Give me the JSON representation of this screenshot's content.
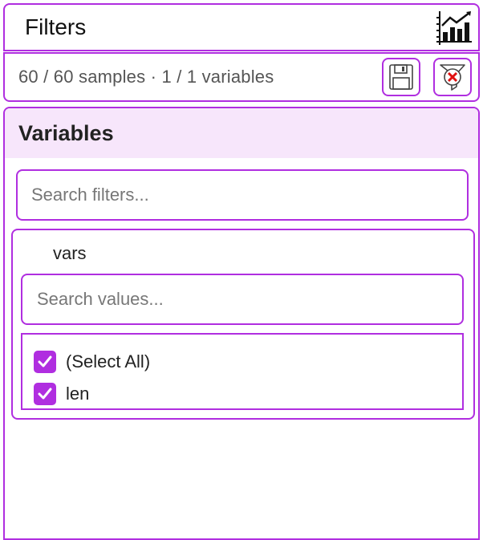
{
  "header": {
    "title": "Filters",
    "chart_icon": "bar-chart-icon"
  },
  "summary": {
    "text": "60 / 60 samples · 1 / 1 variables",
    "save_icon": "floppy-disk-icon",
    "clear_icon": "filter-clear-icon"
  },
  "panel": {
    "title": "Variables",
    "search_placeholder": "Search filters...",
    "group": {
      "label": "vars",
      "values_placeholder": "Search values...",
      "options": [
        {
          "label": "(Select All)",
          "checked": true
        },
        {
          "label": "len",
          "checked": true
        }
      ]
    }
  },
  "colors": {
    "accent": "#b02ee0",
    "panel_header_bg": "#f7e6fb",
    "clear_x": "#e01010"
  }
}
